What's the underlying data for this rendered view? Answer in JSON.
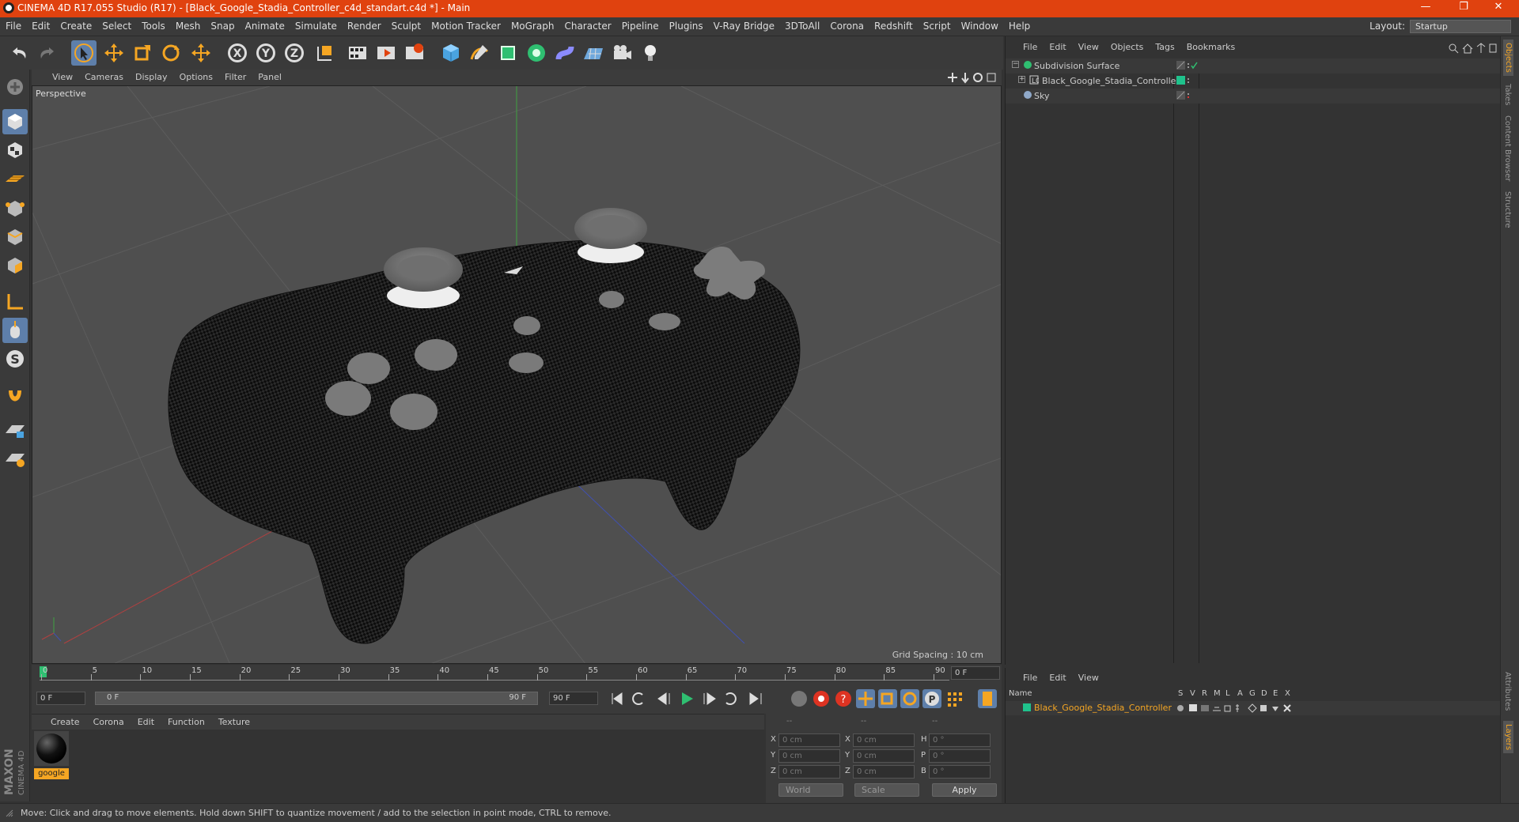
{
  "titlebar": {
    "title": "CINEMA 4D R17.055 Studio (R17) - [Black_Google_Stadia_Controller_c4d_standart.c4d *] - Main",
    "minimize": "—",
    "restore": "❐",
    "close": "✕"
  },
  "menubar": {
    "items": [
      "File",
      "Edit",
      "Create",
      "Select",
      "Tools",
      "Mesh",
      "Snap",
      "Animate",
      "Simulate",
      "Render",
      "Sculpt",
      "Motion Tracker",
      "MoGraph",
      "Character",
      "Pipeline",
      "Plugins",
      "V-Ray Bridge",
      "3DToAll",
      "Corona",
      "Redshift",
      "Script",
      "Window",
      "Help"
    ],
    "layout_label": "Layout:",
    "layout_value": "Startup"
  },
  "viewport": {
    "menu": [
      "View",
      "Cameras",
      "Display",
      "Options",
      "Filter",
      "Panel"
    ],
    "label": "Perspective",
    "grid_spacing": "Grid Spacing : 10 cm"
  },
  "timeline": {
    "ticks": [
      "0",
      "5",
      "10",
      "15",
      "20",
      "25",
      "30",
      "35",
      "40",
      "45",
      "50",
      "55",
      "60",
      "65",
      "70",
      "75",
      "80",
      "85",
      "90"
    ],
    "end_frame": "0 F",
    "start_field": "0 F",
    "slider_start": "0 F",
    "slider_end": "90 F",
    "end_field": "90 F"
  },
  "material_manager": {
    "menu": [
      "Create",
      "Corona",
      "Edit",
      "Function",
      "Texture"
    ],
    "materials": [
      {
        "name": "google"
      }
    ]
  },
  "coordinates": {
    "headers": [
      "--",
      "--",
      "--"
    ],
    "rows": [
      {
        "a": "X",
        "av": "0 cm",
        "b": "X",
        "bv": "0 cm",
        "c": "H",
        "cv": "0 °"
      },
      {
        "a": "Y",
        "av": "0 cm",
        "b": "Y",
        "bv": "0 cm",
        "c": "P",
        "cv": "0 °"
      },
      {
        "a": "Z",
        "av": "0 cm",
        "b": "Z",
        "bv": "0 cm",
        "c": "B",
        "cv": "0 °"
      }
    ],
    "mode": "World",
    "scale": "Scale",
    "apply": "Apply"
  },
  "object_manager": {
    "menu": [
      "File",
      "Edit",
      "View",
      "Objects",
      "Tags",
      "Bookmarks"
    ],
    "objects": [
      {
        "name": "Subdivision Surface"
      },
      {
        "name": "Black_Google_Stadia_Controller"
      },
      {
        "name": "Sky"
      }
    ]
  },
  "attribute_manager": {
    "menu": [
      "File",
      "Edit",
      "View"
    ],
    "columns": [
      "Name",
      "S",
      "V",
      "R",
      "M",
      "L",
      "A",
      "G",
      "D",
      "E",
      "X"
    ],
    "rows": [
      {
        "name": "Black_Google_Stadia_Controller"
      }
    ]
  },
  "right_tabs": [
    "Objects",
    "Takes",
    "Content Browser",
    "Structure",
    "Attributes",
    "Layers"
  ],
  "logo": {
    "brand": "MAXON",
    "product": "CINEMA 4D"
  },
  "status": "Move: Click and drag to move elements. Hold down SHIFT to quantize movement / add to the selection in point mode, CTRL to remove.",
  "colors": {
    "titlebar": "#e0420f",
    "accent": "#f5a623",
    "active_tool": "#5e7faa",
    "layer_green": "#1fc28c"
  }
}
